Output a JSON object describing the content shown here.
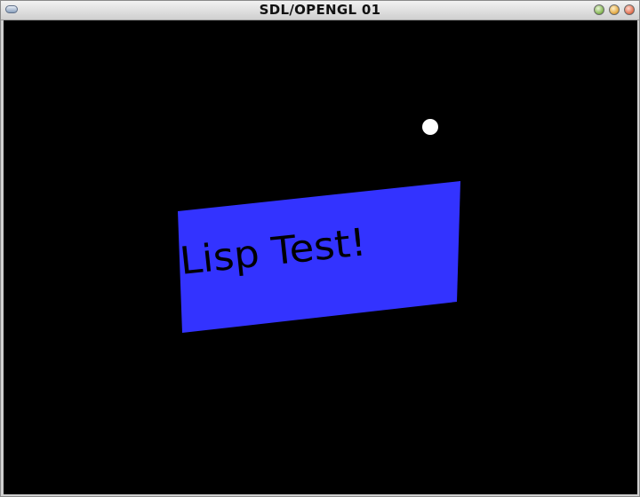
{
  "window": {
    "title": "SDL/OPENGL 01"
  },
  "scene": {
    "background_color": "#000000",
    "panel_color": "#3333ff",
    "panel_text": "Lisp Test!",
    "panel_text_color": "#000000",
    "sphere_color": "#ffffff"
  }
}
